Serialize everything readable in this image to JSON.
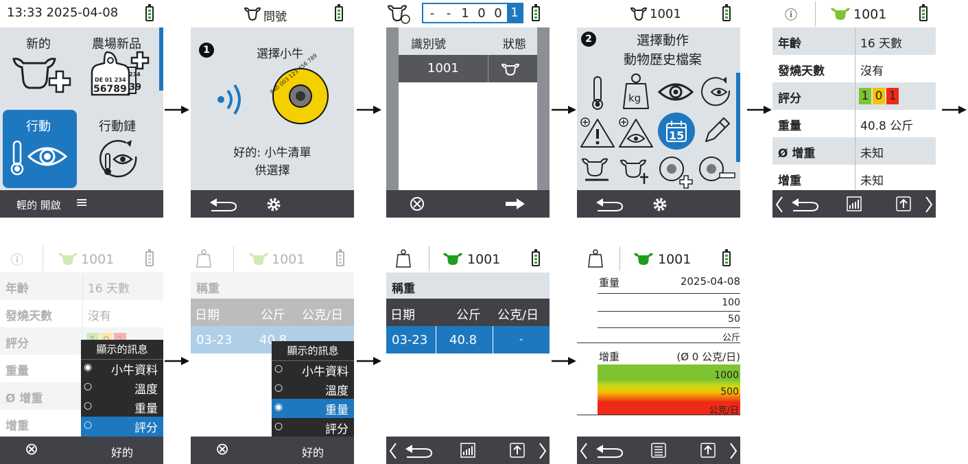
{
  "s1": {
    "time": "13:33 2025-04-08",
    "new": "新的",
    "new_farm": "農場新品",
    "tag_line1": "DE 01 234",
    "tag_num": "56789",
    "tag_side": "234",
    "tag_side2": "39",
    "action": "行動",
    "action_chain": "行動鏈",
    "footer": "輕的 開啟",
    "menu_icon": "≡"
  },
  "s2": {
    "title": "問號",
    "step": "1",
    "heading": "選擇小牛",
    "tag_text": "840 003 123 456 789",
    "msg1": "好的: 小牛清單",
    "msg2": "供選擇"
  },
  "s3": {
    "digits": [
      "-",
      "-",
      "1",
      "0",
      "0",
      "1"
    ],
    "col_id": "識別號",
    "col_status": "狀態",
    "row_id": "1001"
  },
  "s4": {
    "id": "1001",
    "step": "2",
    "line1": "選擇動作",
    "line2": "動物歷史檔案",
    "kg": "kg",
    "date_num": "15"
  },
  "s5": {
    "id": "1001",
    "info": "ⓘ",
    "rows": [
      {
        "label": "年齡",
        "value": "16 天數"
      },
      {
        "label": "發燒天數",
        "value": "沒有"
      },
      {
        "label": "評分",
        "value": ""
      },
      {
        "label": "重量",
        "value": "40.8 公斤"
      },
      {
        "label": "Ø 增重",
        "value": "未知"
      },
      {
        "label": "增重",
        "value": "未知"
      }
    ],
    "scores": [
      "1",
      "0",
      "1"
    ]
  },
  "s6": {
    "id": "1001",
    "menu_title": "顯示的訊息",
    "options": [
      "小牛資料",
      "溫度",
      "重量",
      "評分"
    ],
    "cancel": "⊗",
    "ok": "好的"
  },
  "s7": {
    "id": "1001",
    "heading": "稱重",
    "col_date": "日期",
    "col_kg": "公斤",
    "col_gday": "公克/日",
    "date": "03-23",
    "kg": "40.8",
    "menu_title": "顯示的訊息",
    "options": [
      "小牛資料",
      "溫度",
      "重量",
      "評分"
    ],
    "ok": "好的"
  },
  "s8": {
    "id": "1001",
    "heading": "稱重",
    "col_date": "日期",
    "col_kg": "公斤",
    "col_gday": "公克/日",
    "date": "03-23",
    "kg": "40.8",
    "gday": "-"
  },
  "s9": {
    "id": "1001",
    "weight_label": "重量",
    "date": "2025-04-08",
    "w100": "100",
    "w50": "50",
    "wunit": "公斤",
    "gain_label": "增重",
    "gain_avg": "(Ø 0 公克/日)",
    "g1000": "1000",
    "g500": "500",
    "gunit": "公克/日"
  },
  "colors": {
    "accent": "#1e78c0",
    "dark": "#404247",
    "panel": "#dde2e7",
    "green": "#7ec431",
    "red": "#ee2a16",
    "yellow": "#f4c400"
  }
}
